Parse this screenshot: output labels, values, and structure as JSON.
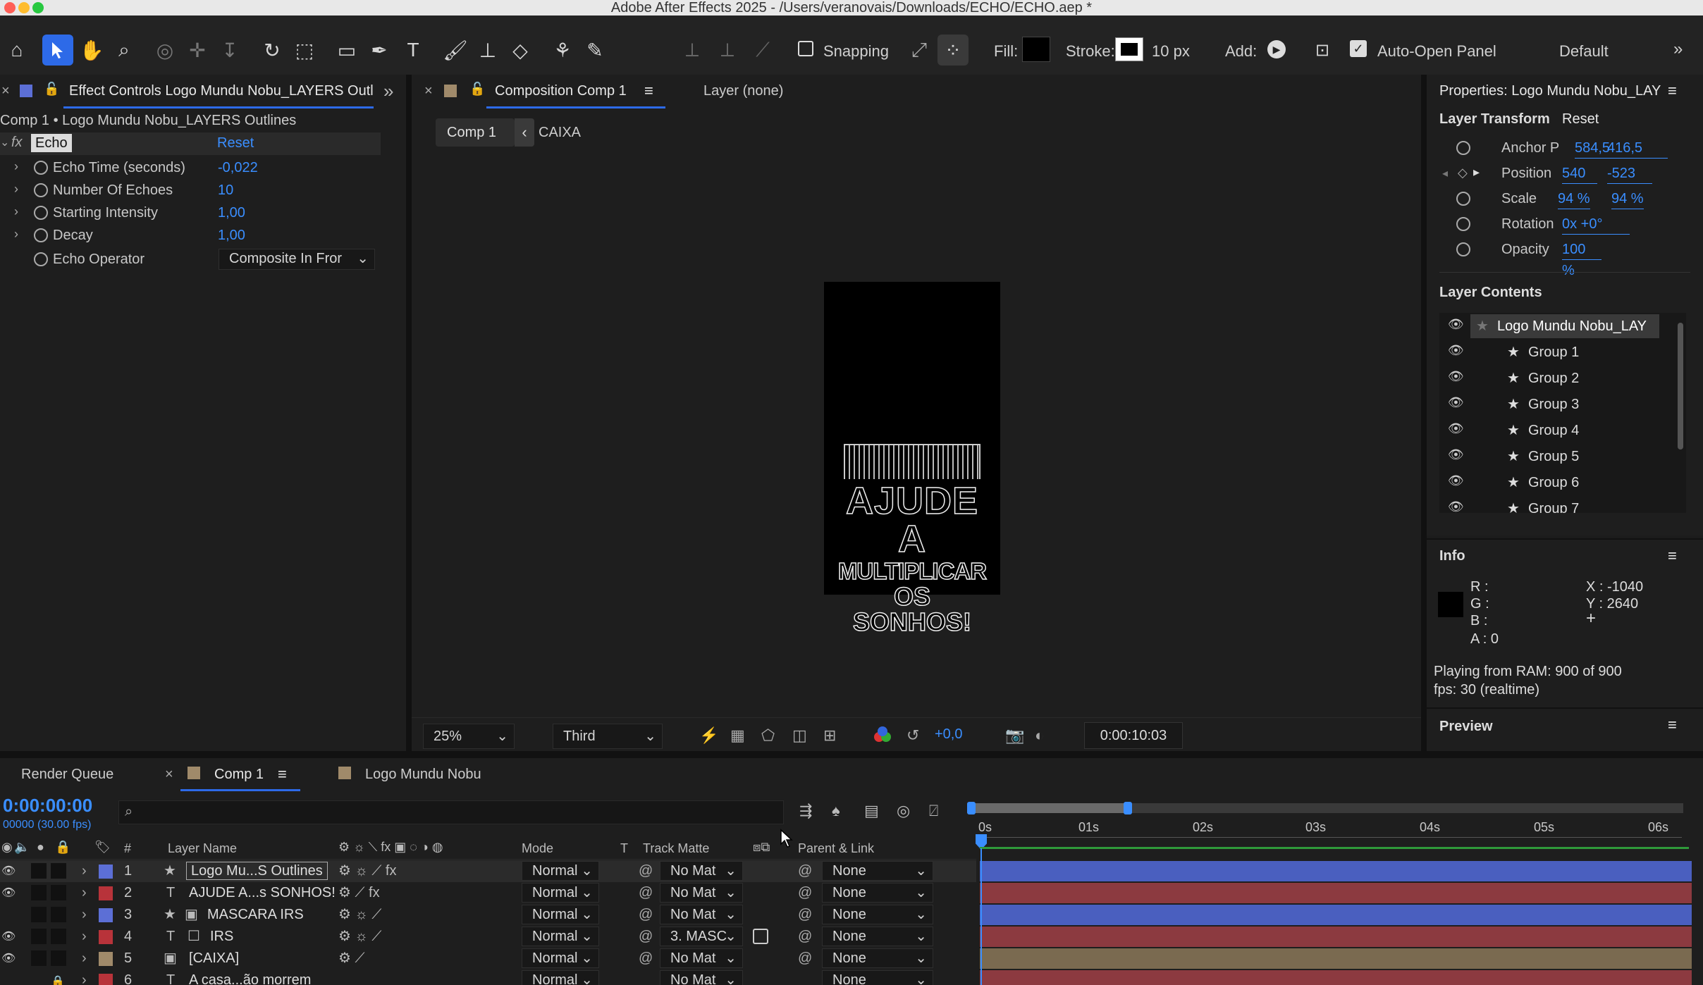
{
  "window": {
    "title": "Adobe After Effects 2025 - /Users/veranovais/Downloads/ECHO/ECHO.aep *"
  },
  "toolbar": {
    "snapping_label": "Snapping",
    "fill_label": "Fill:",
    "stroke_label": "Stroke:",
    "stroke_width": "10 px",
    "add_label": "Add:",
    "auto_open_label": "Auto-Open Panel",
    "workspace": "Default"
  },
  "effect_controls": {
    "tab_title": "Effect Controls Logo Mundu Nobu_LAYERS Outl",
    "subtitle": "Comp 1 • Logo Mundu Nobu_LAYERS Outlines",
    "effect_name": "Echo",
    "reset_label": "Reset",
    "props": [
      {
        "name": "Echo Time (seconds)",
        "value": "-0,022"
      },
      {
        "name": "Number Of Echoes",
        "value": "10"
      },
      {
        "name": "Starting Intensity",
        "value": "1,00"
      },
      {
        "name": "Decay",
        "value": "1,00"
      }
    ],
    "operator_label": "Echo Operator",
    "operator_value": "Composite In Fror"
  },
  "composition": {
    "tab_title": "Composition Comp 1",
    "layer_tab": "Layer (none)",
    "breadcrumb_current": "Comp 1",
    "breadcrumb_next": "CAIXA",
    "art_lines": [
      "AJUDE A",
      "MULTIPLICAR",
      "OS SONHOS!"
    ],
    "zoom": "25%",
    "resolution": "Third",
    "exposure": "+0,0",
    "timecode": "0:00:10:03"
  },
  "properties": {
    "title": "Properties: Logo Mundu Nobu_LAY",
    "transform_label": "Layer Transform",
    "reset_label": "Reset",
    "rows": [
      {
        "name": "Anchor P",
        "v1": "584,5",
        "v2": "416,5"
      },
      {
        "name": "Position",
        "v1": "540",
        "v2": "-523"
      },
      {
        "name": "Scale",
        "v1": "94 %",
        "v2": "94 %"
      },
      {
        "name": "Rotation",
        "v1": "0x +0°",
        "v2": ""
      },
      {
        "name": "Opacity",
        "v1": "100 %",
        "v2": ""
      }
    ],
    "contents_label": "Layer Contents",
    "contents": [
      "Logo Mundu Nobu_LAY",
      "Group 1",
      "Group 2",
      "Group 3",
      "Group 4",
      "Group 5",
      "Group 6",
      "Group 7"
    ]
  },
  "info": {
    "title": "Info",
    "r": "R :",
    "g": "G :",
    "b": "B :",
    "a": "A : 0",
    "x": "X : -1040",
    "y": "Y : 2640",
    "ram": "Playing from RAM: 900 of 900",
    "fps": "fps: 30 (realtime)"
  },
  "preview": {
    "title": "Preview"
  },
  "timeline": {
    "tabs": [
      "Render Queue",
      "Comp 1",
      "Logo Mundu Nobu"
    ],
    "timecode": "0:00:00:00",
    "frames": "00000 (30.00 fps)",
    "col_layer_name": "Layer Name",
    "col_mode": "Mode",
    "col_t": "T",
    "col_track_matte": "Track Matte",
    "col_parent": "Parent & Link",
    "ruler": [
      "0s",
      "01s",
      "02s",
      "03s",
      "04s",
      "05s",
      "06s"
    ],
    "layers": [
      {
        "num": "1",
        "type": "★",
        "name": "Logo Mu...S Outlines",
        "mode": "Normal",
        "matte": "No Mat",
        "parent": "None",
        "color": "#5c6fd6",
        "bar": "#4a5fbf"
      },
      {
        "num": "2",
        "type": "T",
        "name": "AJUDE A...s SONHOS!",
        "mode": "Normal",
        "matte": "No Mat",
        "parent": "None",
        "color": "#b8333a",
        "bar": "#8c3a40"
      },
      {
        "num": "3",
        "type": "★",
        "name": "MASCARA IRS",
        "mode": "Normal",
        "matte": "No Mat",
        "parent": "None",
        "color": "#5c6fd6",
        "bar": "#4a5fbf"
      },
      {
        "num": "4",
        "type": "T",
        "name": "IRS",
        "mode": "Normal",
        "matte": "3. MASC",
        "parent": "None",
        "color": "#b8333a",
        "bar": "#8c3a40"
      },
      {
        "num": "5",
        "type": "▣",
        "name": "[CAIXA]",
        "mode": "Normal",
        "matte": "No Mat",
        "parent": "None",
        "color": "#a08a6a",
        "bar": "#7a6a50"
      },
      {
        "num": "6",
        "type": "T",
        "name": "A casa...ão morrem",
        "mode": "Normal",
        "matte": "No Mat",
        "parent": "None",
        "color": "#b8333a",
        "bar": "#8c3a40"
      }
    ]
  }
}
